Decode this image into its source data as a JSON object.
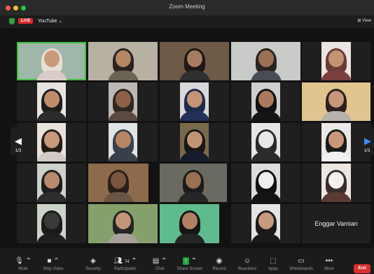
{
  "window": {
    "title": "Zoom Meeting"
  },
  "meeting_bar": {
    "live_badge": "LIVE",
    "stream_label": "YouTube ⌄",
    "view_label": "View"
  },
  "pagination": {
    "left_page": "1/3",
    "right_page": "1/3"
  },
  "named_tiles": [
    {
      "name": "Enggar Vamian"
    }
  ],
  "toolbar": {
    "mute": "Mute",
    "stop_video": "Stop Video",
    "security": "Security",
    "participants": "Participants",
    "participants_count": "74",
    "chat": "Chat",
    "share_screen": "Share Screen",
    "record": "Record",
    "reactions": "Reactions",
    "apps": "Apps",
    "whiteboards": "Whiteboards",
    "more": "More",
    "end": "End"
  },
  "colors": {
    "end_button": "#d92f2f",
    "live_badge": "#e02828",
    "active_speaker_border": "#3fbf3f",
    "share_button": "#20a040"
  }
}
